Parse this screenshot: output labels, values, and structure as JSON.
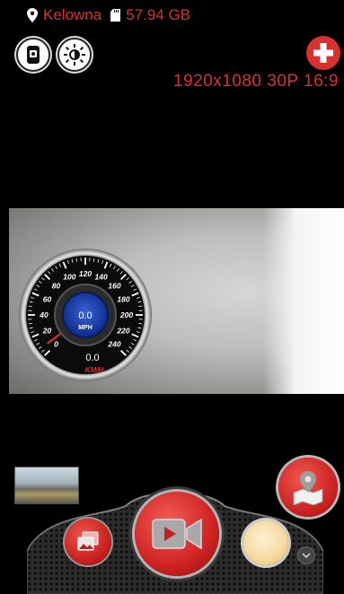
{
  "status": {
    "location": "Kelowna",
    "storage": "57.94 GB",
    "color": "#d9312f"
  },
  "camera": {
    "resolution": "1920x1080 30P 16:9"
  },
  "speedometer": {
    "speed_value": "0.0",
    "speed_unit": "MPH",
    "odometer_value": "0.0",
    "scale_unit": "KM/H",
    "ticks": [
      "0",
      "20",
      "40",
      "60",
      "80",
      "100",
      "120",
      "140",
      "160",
      "180",
      "200",
      "220",
      "240"
    ],
    "needle_value": 0
  },
  "icons": {
    "location": "map-pin-icon",
    "storage": "sd-card-icon",
    "screen_toggle": "phone-screen-icon",
    "brightness": "brightness-icon",
    "add": "plus-icon",
    "map": "map-location-icon",
    "gallery": "gallery-icon",
    "record": "video-camera-icon",
    "expand": "chevron-down-icon"
  }
}
